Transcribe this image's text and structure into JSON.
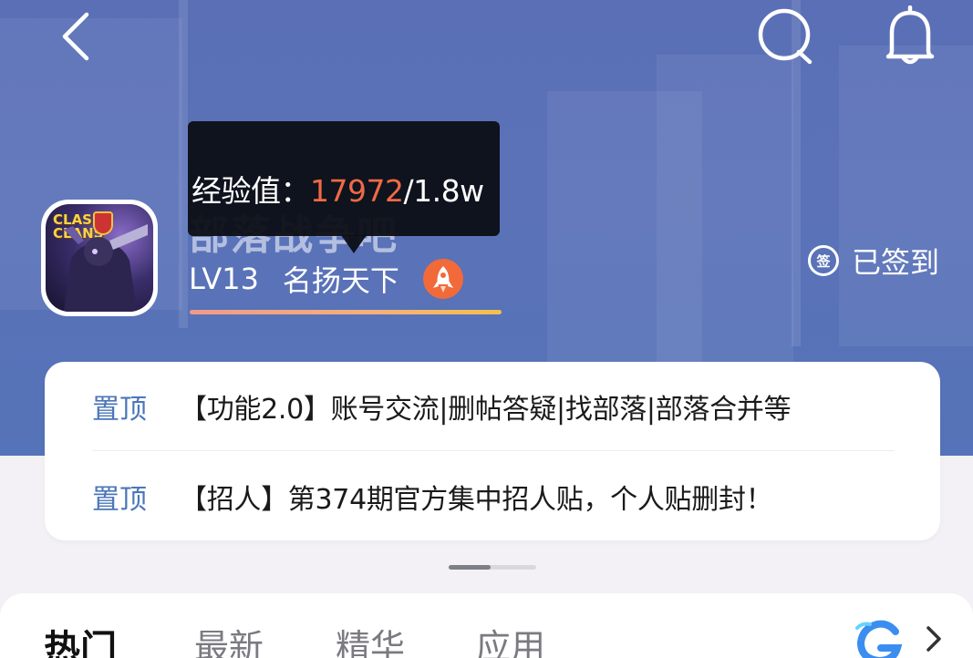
{
  "header": {
    "back_icon": "chevron-left-icon",
    "search_icon": "search-icon",
    "bell_icon": "bell-icon"
  },
  "forum": {
    "name": "部落战争吧",
    "level": "LV13",
    "level_title": "名扬天下",
    "rank_icon": "rocket-icon",
    "avatar_logo": "CLASH CLANS",
    "experience": {
      "label": "经验值：",
      "current": "17972",
      "separator": "/",
      "max": "1.8w",
      "progress_fraction": 0.998
    },
    "signed_label": "已签到",
    "signed_icon_text": "签"
  },
  "pinned": [
    {
      "tag": "置顶",
      "title": "【功能2.0】账号交流|删帖答疑|找部落|部落合并等"
    },
    {
      "tag": "置顶",
      "title": "【招人】第374期官方集中招人贴，个人贴删封！"
    }
  ],
  "pager": {
    "pages": 2,
    "active": 1
  },
  "tabs": [
    {
      "label": "热门",
      "active": true
    },
    {
      "label": "最新",
      "active": false
    },
    {
      "label": "精华",
      "active": false
    },
    {
      "label": "应用",
      "active": false
    }
  ],
  "colors": {
    "banner": "#5a6fb6",
    "accent_orange": "#ef6a46",
    "pin_tag": "#4b76b8"
  }
}
